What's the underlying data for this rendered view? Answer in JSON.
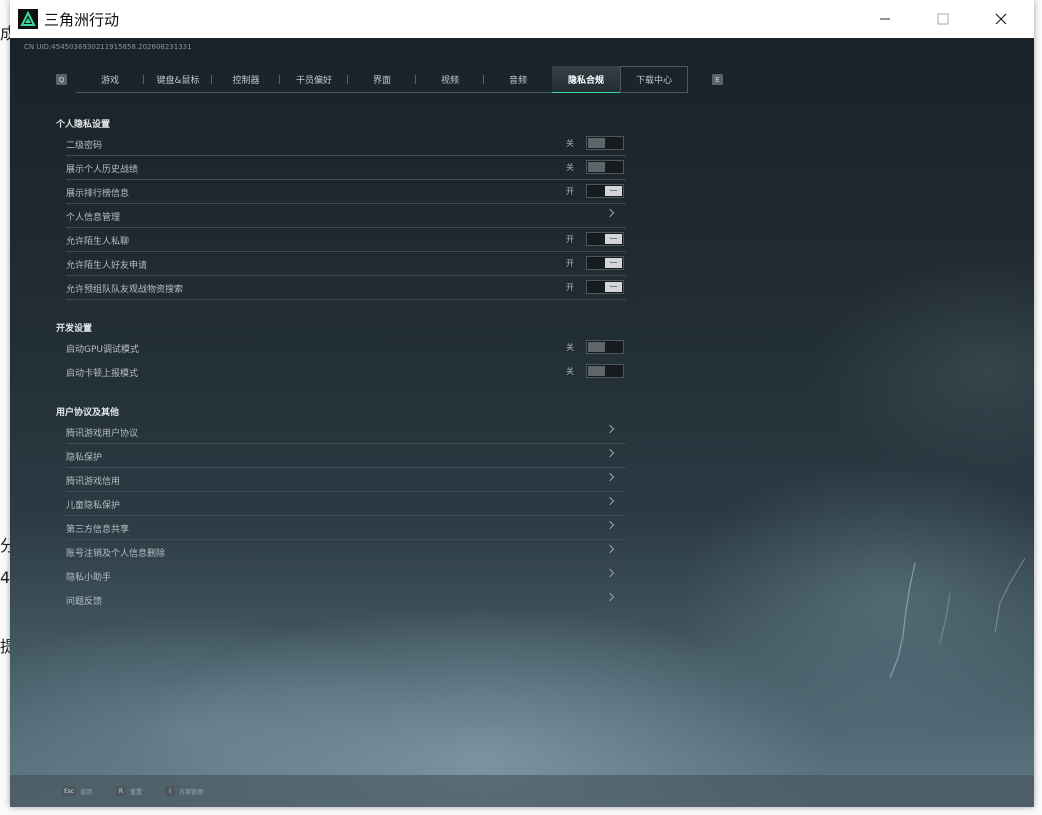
{
  "window": {
    "title": "三角洲行动"
  },
  "uid": "CN UID:4545036930211915858.202608231331",
  "background_glyphs": [
    "成",
    "分",
    "4",
    "提"
  ],
  "tabbar": {
    "prev_key": "Q",
    "next_key": "E",
    "tabs": [
      {
        "label": "游戏"
      },
      {
        "label": "键盘&鼠标"
      },
      {
        "label": "控制器"
      },
      {
        "label": "干员偏好"
      },
      {
        "label": "界面"
      },
      {
        "label": "视频"
      },
      {
        "label": "音频"
      },
      {
        "label": "隐私合规",
        "active": true
      },
      {
        "label": "下载中心"
      }
    ]
  },
  "sections": {
    "privacy": {
      "title": "个人隐私设置",
      "rows": [
        {
          "label": "二级密码",
          "state": "关"
        },
        {
          "label": "展示个人历史战绩",
          "state": "关"
        },
        {
          "label": "展示排行榜信息",
          "state": "开"
        },
        {
          "label": "个人信息管理"
        },
        {
          "label": "允许陌生人私聊",
          "state": "开"
        },
        {
          "label": "允许陌生人好友申请",
          "state": "开"
        },
        {
          "label": "允许预组队队友观战物资搜索",
          "state": "开"
        }
      ]
    },
    "developer": {
      "title": "开发设置",
      "rows": [
        {
          "label": "启动GPU调试模式",
          "state": "关"
        },
        {
          "label": "启动卡顿上报模式",
          "state": "关"
        }
      ]
    },
    "agreements": {
      "title": "用户协议及其他",
      "rows": [
        {
          "label": "腾讯游戏用户协议"
        },
        {
          "label": "隐私保护"
        },
        {
          "label": "腾讯游戏信用"
        },
        {
          "label": "儿童隐私保护"
        },
        {
          "label": "第三方信息共享"
        },
        {
          "label": "账号注销及个人信息删除"
        },
        {
          "label": "隐私小助手"
        },
        {
          "label": "问题反馈"
        }
      ]
    }
  },
  "footer": {
    "hints": [
      {
        "key": "Esc",
        "label": "返回"
      },
      {
        "key": "R",
        "label": "重置"
      },
      {
        "key": "I",
        "label": "方案管理"
      }
    ]
  },
  "colors": {
    "accent": "#39d99a",
    "toggle_on": "#d2d6d8",
    "toggle_off": "#5e666b",
    "divider": "#3f4b52"
  }
}
